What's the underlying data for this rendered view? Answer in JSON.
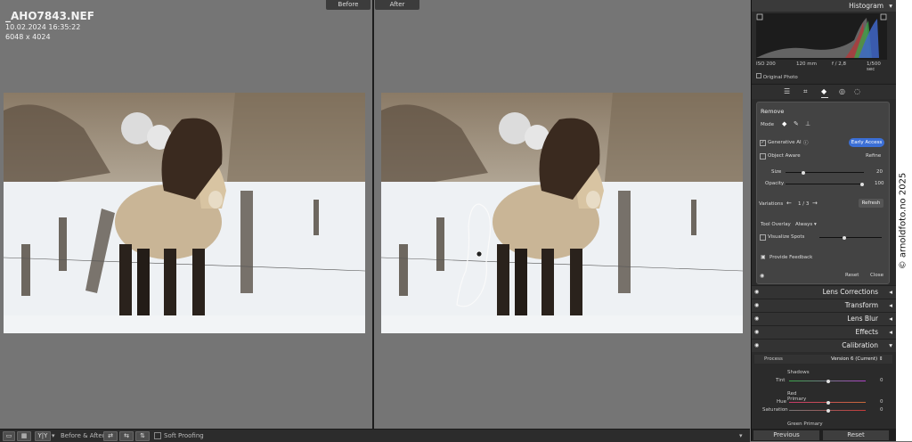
{
  "compare": {
    "before_label": "Before",
    "after_label": "After"
  },
  "file": {
    "name": "_AHO7843.NEF",
    "datetime": "10.02.2024 16:35:22",
    "dimensions": "6048 x 4024"
  },
  "toolbar": {
    "before_after_label": "Before & After :",
    "soft_proofing": "Soft Proofing",
    "view_yy": "Y|Y"
  },
  "histogram": {
    "title": "Histogram",
    "iso": "ISO 200",
    "focal": "120 mm",
    "aperture": "f / 2,8",
    "shutter": "1/500 sec",
    "source": "Original Photo"
  },
  "remove": {
    "title": "Remove",
    "mode_label": "Mode",
    "generative_ai": "Generative AI",
    "generative_ai_checked": true,
    "early_access": "Early Access",
    "object_aware": "Object Aware",
    "refine": "Refine",
    "size_label": "Size",
    "size_value": "20",
    "opacity_label": "Opacity",
    "opacity_value": "100",
    "variations_label": "Variations",
    "variations_counter": "1 / 3",
    "refresh": "Refresh",
    "tool_overlay_label": "Tool Overlay",
    "tool_overlay_value": "Always",
    "visualize_spots": "Visualize Spots",
    "provide_feedback": "Provide Feedback",
    "reset": "Reset",
    "close": "Close"
  },
  "sections": {
    "lens_corrections": "Lens Corrections",
    "transform": "Transform",
    "lens_blur": "Lens Blur",
    "effects": "Effects",
    "calibration": "Calibration"
  },
  "calibration": {
    "process_label": "Process",
    "process_value": "Version 6 (Current)",
    "shadows": "Shadows",
    "tint_label": "Tint",
    "tint_value": "0",
    "red_primary": "Red Primary",
    "hue_label": "Hue",
    "hue_value": "0",
    "saturation_label": "Saturation",
    "saturation_value": "0",
    "green_primary": "Green Primary"
  },
  "bottom_buttons": {
    "previous": "Previous",
    "reset": "Reset"
  },
  "watermark": "© arnoldfoto.no 2025",
  "colors": {
    "accent_blue": "#3b6fd6",
    "panel_bg": "#2b2b2b",
    "viewport_bg": "#757575"
  }
}
